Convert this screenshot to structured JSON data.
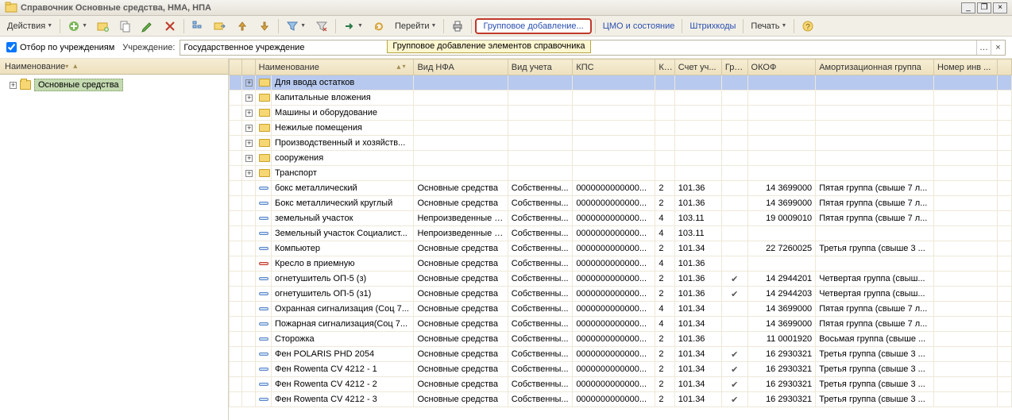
{
  "title": "Справочник Основные средства, НМА, НПА",
  "toolbar": {
    "actions": "Действия",
    "go": "Перейти",
    "group_add": "Групповое добавление...",
    "cmo": "ЦМО и состояние",
    "barcodes": "Штрихкоды",
    "print": "Печать"
  },
  "filter": {
    "chk_label": "Отбор по учреждениям",
    "inst_label": "Учреждение:",
    "inst_value": "Государственное учреждение",
    "tooltip": "Групповое добавление элементов справочника"
  },
  "left": {
    "header": "Наименование",
    "root": "Основные средства"
  },
  "grid": {
    "headers": {
      "name": "Наименование",
      "nfa": "Вид НФА",
      "uchet": "Вид учета",
      "kps": "КПС",
      "k": "К...",
      "schet": "Счет уч...",
      "grp": "Гру...",
      "okof": "ОКОФ",
      "amort": "Амортизационная группа",
      "num": "Номер инв ..."
    },
    "folders": [
      {
        "name": "Для ввода остатков",
        "sel": true
      },
      {
        "name": "Капитальные вложения"
      },
      {
        "name": "Машины и оборудование"
      },
      {
        "name": "Нежилые помещения"
      },
      {
        "name": "Производственный и хозяйств..."
      },
      {
        "name": "сооружения"
      },
      {
        "name": "Транспорт"
      }
    ],
    "rows": [
      {
        "name": "бокс металлический",
        "nfa": "Основные средства",
        "uch": "Собственны...",
        "kps": "0000000000000...",
        "k": "2",
        "sch": "101.36",
        "grp": "",
        "okof": "14 3699000",
        "amo": "Пятая группа (свыше 7 л...",
        "ic": "item"
      },
      {
        "name": "Бокс металлический круглый",
        "nfa": "Основные средства",
        "uch": "Собственны...",
        "kps": "0000000000000...",
        "k": "2",
        "sch": "101.36",
        "grp": "",
        "okof": "14 3699000",
        "amo": "Пятая группа (свыше 7 л...",
        "ic": "item"
      },
      {
        "name": "земельный участок",
        "nfa": "Непроизведенные а...",
        "uch": "Собственны...",
        "kps": "0000000000000...",
        "k": "4",
        "sch": "103.11",
        "grp": "",
        "okof": "19 0009010",
        "amo": "Пятая группа (свыше 7 л...",
        "ic": "item"
      },
      {
        "name": "Земельный участок Социалист...",
        "nfa": "Непроизведенные а...",
        "uch": "Собственны...",
        "kps": "0000000000000...",
        "k": "4",
        "sch": "103.11",
        "grp": "",
        "okof": "",
        "amo": "",
        "ic": "item"
      },
      {
        "name": "Компьютер",
        "nfa": "Основные средства",
        "uch": "Собственны...",
        "kps": "0000000000000...",
        "k": "2",
        "sch": "101.34",
        "grp": "",
        "okof": "22 7260025",
        "amo": "Третья группа (свыше 3 ...",
        "ic": "item"
      },
      {
        "name": "Кресло в приемную",
        "nfa": "Основные средства",
        "uch": "Собственны...",
        "kps": "0000000000000...",
        "k": "4",
        "sch": "101.36",
        "grp": "",
        "okof": "",
        "amo": "",
        "ic": "red"
      },
      {
        "name": "огнетушитель ОП-5 (з)",
        "nfa": "Основные средства",
        "uch": "Собственны...",
        "kps": "0000000000000...",
        "k": "2",
        "sch": "101.36",
        "grp": "✓",
        "okof": "14 2944201",
        "amo": "Четвертая группа (свыш...",
        "ic": "item"
      },
      {
        "name": "огнетушитель ОП-5 (з1)",
        "nfa": "Основные средства",
        "uch": "Собственны...",
        "kps": "0000000000000...",
        "k": "2",
        "sch": "101.36",
        "grp": "✓",
        "okof": "14 2944203",
        "amo": "Четвертая группа (свыш...",
        "ic": "item"
      },
      {
        "name": "Охранная сигнализация (Соц 7...",
        "nfa": "Основные средства",
        "uch": "Собственны...",
        "kps": "0000000000000...",
        "k": "4",
        "sch": "101.34",
        "grp": "",
        "okof": "14 3699000",
        "amo": "Пятая группа (свыше 7 л...",
        "ic": "item"
      },
      {
        "name": "Пожарная сигнализация(Соц 7...",
        "nfa": "Основные средства",
        "uch": "Собственны...",
        "kps": "0000000000000...",
        "k": "4",
        "sch": "101.34",
        "grp": "",
        "okof": "14 3699000",
        "amo": "Пятая группа (свыше 7 л...",
        "ic": "item"
      },
      {
        "name": "Сторожка",
        "nfa": "Основные средства",
        "uch": "Собственны...",
        "kps": "0000000000000...",
        "k": "2",
        "sch": "101.36",
        "grp": "",
        "okof": "11 0001920",
        "amo": "Восьмая группа (свыше ...",
        "ic": "item"
      },
      {
        "name": "Фен POLARIS PHD 2054",
        "nfa": "Основные средства",
        "uch": "Собственны...",
        "kps": "0000000000000...",
        "k": "2",
        "sch": "101.34",
        "grp": "✓",
        "okof": "16 2930321",
        "amo": "Третья группа (свыше 3 ...",
        "ic": "item"
      },
      {
        "name": "Фен Rowenta CV 4212 - 1",
        "nfa": "Основные средства",
        "uch": "Собственны...",
        "kps": "0000000000000...",
        "k": "2",
        "sch": "101.34",
        "grp": "✓",
        "okof": "16 2930321",
        "amo": "Третья группа (свыше 3 ...",
        "ic": "item"
      },
      {
        "name": "Фен Rowenta CV 4212 - 2",
        "nfa": "Основные средства",
        "uch": "Собственны...",
        "kps": "0000000000000...",
        "k": "2",
        "sch": "101.34",
        "grp": "✓",
        "okof": "16 2930321",
        "amo": "Третья группа (свыше 3 ...",
        "ic": "item"
      },
      {
        "name": "Фен Rowenta CV 4212 - 3",
        "nfa": "Основные средства",
        "uch": "Собственны...",
        "kps": "0000000000000...",
        "k": "2",
        "sch": "101.34",
        "grp": "✓",
        "okof": "16 2930321",
        "amo": "Третья группа (свыше 3 ...",
        "ic": "item"
      }
    ]
  }
}
